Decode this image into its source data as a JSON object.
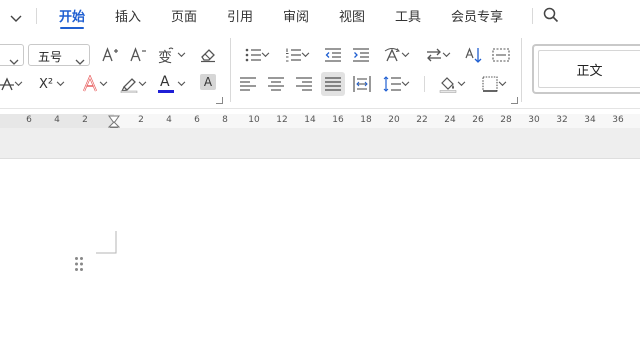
{
  "menu": {
    "collapse_icon": "chevron-down-icon",
    "tabs": [
      {
        "label": "开始",
        "active": true
      },
      {
        "label": "插入"
      },
      {
        "label": "页面"
      },
      {
        "label": "引用"
      },
      {
        "label": "审阅"
      },
      {
        "label": "视图"
      },
      {
        "label": "工具"
      },
      {
        "label": "会员专享"
      }
    ],
    "search_icon": "search-icon"
  },
  "ribbon": {
    "font_size": {
      "value": "五号"
    },
    "style_gallery": {
      "current": "正文"
    },
    "text_buttons": {
      "superscript": "X²",
      "font_color": "A",
      "shading": "A"
    },
    "colors": {
      "accent": "#1f5fd1",
      "font_color_bar": "#1f1fd6",
      "highlight_bar": "#e8e8e8"
    }
  },
  "ruler": {
    "ticks_left": [
      "6",
      "4",
      "2"
    ],
    "ticks_right": [
      "2",
      "4",
      "6",
      "8",
      "10",
      "12",
      "14",
      "16",
      "18",
      "20",
      "22",
      "24",
      "26",
      "28",
      "30",
      "32",
      "34",
      "36"
    ]
  }
}
